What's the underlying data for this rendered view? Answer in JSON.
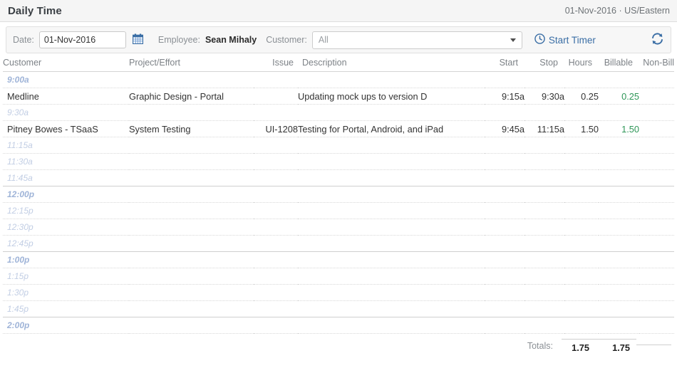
{
  "header": {
    "title": "Daily Time",
    "date": "01-Nov-2016",
    "separator": "·",
    "timezone": "US/Eastern",
    "meta": "01-Nov-2016 · US/Eastern"
  },
  "toolbar": {
    "date_label": "Date:",
    "date_value": "01-Nov-2016",
    "date_placeholder": "dd-Mmm-yyyy",
    "calendar_icon": "calendar-icon",
    "employee_label": "Employee:",
    "employee_value": "Sean Mihaly",
    "customer_label": "Customer:",
    "customer_value": "All",
    "customer_placeholder": "All",
    "start_timer_label": "Start Timer",
    "start_timer_icon": "clock-icon",
    "refresh_icon": "refresh-icon",
    "accent_color": "#3a6ea5"
  },
  "table": {
    "columns": [
      "Customer",
      "Project/Effort",
      "Issue",
      "Description",
      "Start",
      "Stop",
      "Hours",
      "Billable",
      "Non-Bill"
    ],
    "rows": [
      {
        "kind": "slot",
        "time": "9:00a",
        "hour": true
      },
      {
        "kind": "entry",
        "customer": "Medline",
        "project": "Graphic Design - Portal",
        "issue": "",
        "description": "Updating mock ups to version D",
        "start": "9:15a",
        "stop": "9:30a",
        "hours": "0.25",
        "billable": "0.25",
        "nonbill": ""
      },
      {
        "kind": "slot",
        "time": "9:30a",
        "hour": false
      },
      {
        "kind": "entry",
        "customer": "Pitney Bowes - TSaaS",
        "project": "System Testing",
        "issue": "UI-1208",
        "description": "Testing for Portal, Android, and iPad",
        "start": "9:45a",
        "stop": "11:15a",
        "hours": "1.50",
        "billable": "1.50",
        "nonbill": ""
      },
      {
        "kind": "slot",
        "time": "11:15a",
        "hour": false
      },
      {
        "kind": "slot",
        "time": "11:30a",
        "hour": false
      },
      {
        "kind": "slot",
        "time": "11:45a",
        "hour": false
      },
      {
        "kind": "slot",
        "time": "12:00p",
        "hour": true
      },
      {
        "kind": "slot",
        "time": "12:15p",
        "hour": false
      },
      {
        "kind": "slot",
        "time": "12:30p",
        "hour": false
      },
      {
        "kind": "slot",
        "time": "12:45p",
        "hour": false
      },
      {
        "kind": "slot",
        "time": "1:00p",
        "hour": true
      },
      {
        "kind": "slot",
        "time": "1:15p",
        "hour": false
      },
      {
        "kind": "slot",
        "time": "1:30p",
        "hour": false
      },
      {
        "kind": "slot",
        "time": "1:45p",
        "hour": false
      },
      {
        "kind": "slot",
        "time": "2:00p",
        "hour": true
      }
    ]
  },
  "totals": {
    "label": "Totals:",
    "hours": "1.75",
    "billable": "1.75",
    "nonbill": ""
  },
  "colors": {
    "billable_green": "#2e9657",
    "slot_blue": "#c2cee4",
    "slot_hour_blue": "#9fb4d8",
    "link_blue": "#3a6ea5"
  }
}
